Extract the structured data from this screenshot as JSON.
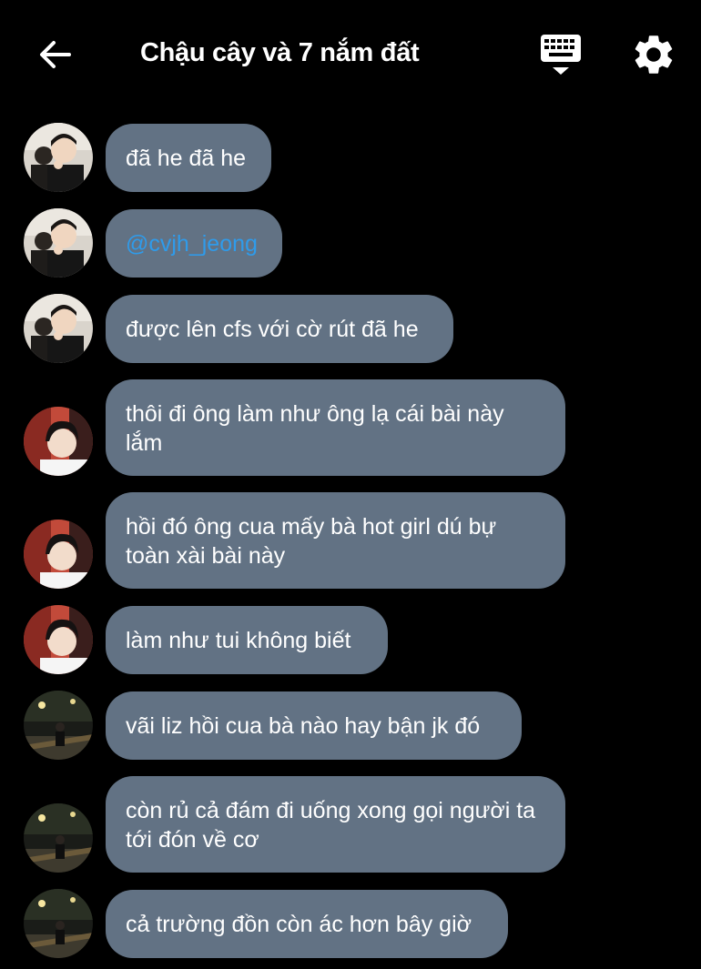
{
  "header": {
    "title": "Chậu cây và 7 nắm đất",
    "back_icon": "arrow-left-icon",
    "keyboard_icon": "keyboard-icon",
    "settings_icon": "gear-icon"
  },
  "colors": {
    "background": "#000000",
    "bubble": "#627284",
    "mention": "#2f9bea",
    "text": "#ffffff"
  },
  "messages": [
    {
      "avatar": "avatar-user-1",
      "text": "đã he đã he"
    },
    {
      "avatar": "avatar-user-1",
      "text": "@cvjh_jeong",
      "mention": true
    },
    {
      "avatar": "avatar-user-1",
      "text": "được lên cfs với cờ rút đã he"
    },
    {
      "avatar": "avatar-user-2",
      "text": "thôi đi ông làm như ông lạ cái bài này lắm"
    },
    {
      "avatar": "avatar-user-2",
      "text": "hồi đó ông cua mấy bà hot girl dú bự toàn xài bài này"
    },
    {
      "avatar": "avatar-user-2",
      "text": "làm như tui không biết"
    },
    {
      "avatar": "avatar-user-3",
      "text": "vãi liz hồi cua bà nào hay bận jk đó"
    },
    {
      "avatar": "avatar-user-3",
      "text": "còn rủ cả đám đi uống xong gọi người ta tới đón về cơ"
    },
    {
      "avatar": "avatar-user-3",
      "text": "cả trường đồn còn ác hơn bây giờ"
    }
  ]
}
